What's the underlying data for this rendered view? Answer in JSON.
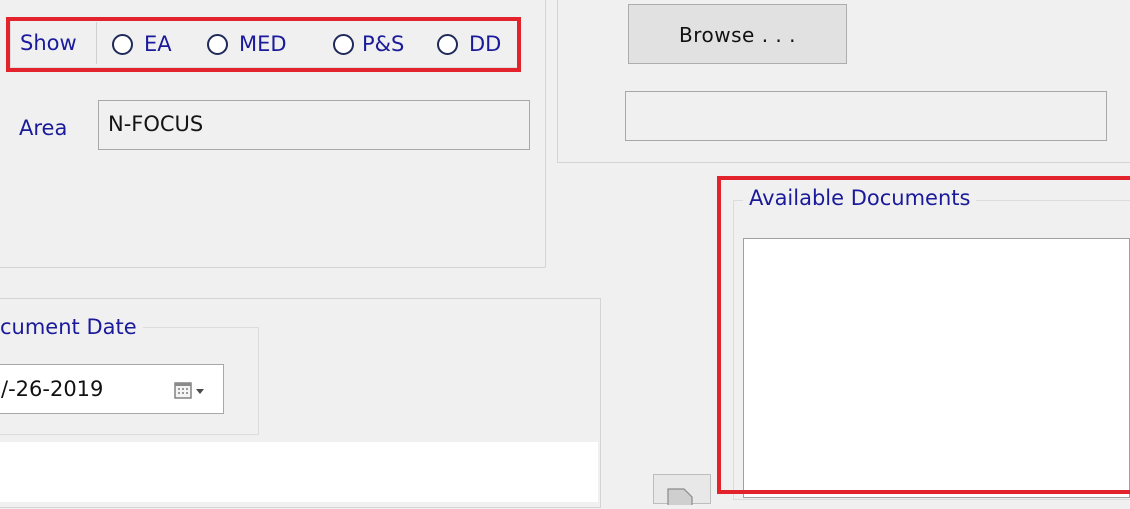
{
  "show": {
    "label": "Show",
    "options": [
      {
        "label": "EA",
        "selected": false
      },
      {
        "label": "MED",
        "selected": false
      },
      {
        "label": "P&S",
        "selected": false
      },
      {
        "label": "DD",
        "selected": false
      }
    ]
  },
  "area": {
    "label": "Area",
    "value": "N-FOCUS"
  },
  "browse": {
    "button_label": "Browse . . .",
    "path_value": ""
  },
  "document_date": {
    "legend": "cument Date",
    "value": "/-26-2019",
    "icon": "calendar-dropdown-icon"
  },
  "available_documents": {
    "legend": "Available Documents",
    "items": []
  },
  "highlight_color": "#e3232c"
}
